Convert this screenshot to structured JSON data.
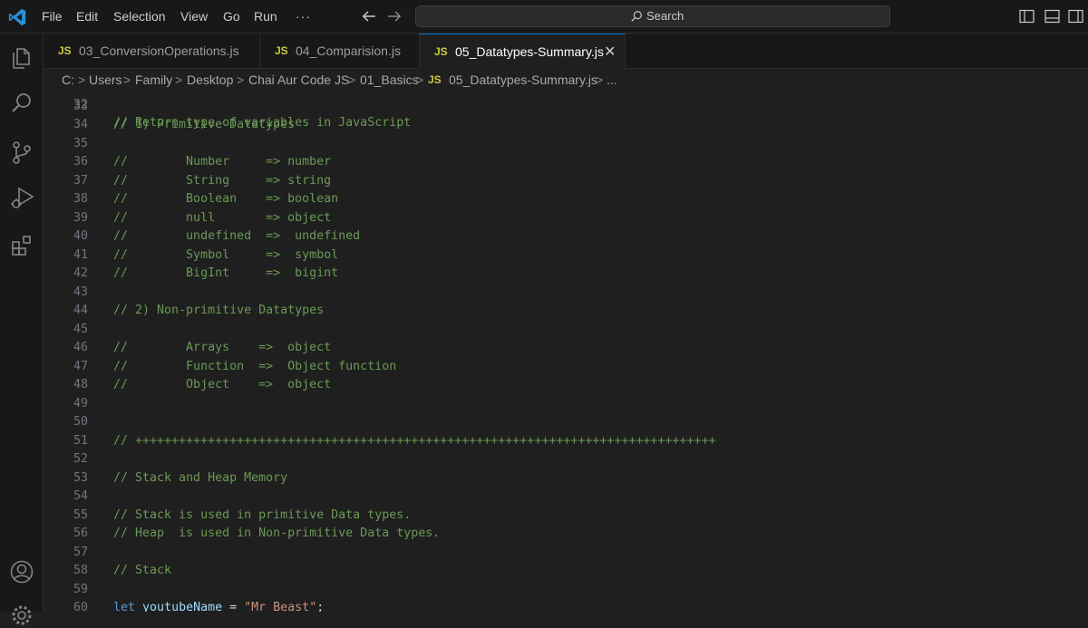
{
  "menu": [
    "File",
    "Edit",
    "Selection",
    "View",
    "Go",
    "Run",
    "···"
  ],
  "search": {
    "label": "Search"
  },
  "tabs": [
    {
      "badge": "JS",
      "label": "03_ConversionOperations.js"
    },
    {
      "badge": "JS",
      "label": "04_Comparision.js"
    },
    {
      "badge": "JS",
      "label": "05_Datatypes-Summary.js",
      "active": true
    }
  ],
  "tab_close_glyph": "✕",
  "breadcrumb": {
    "items": [
      "C:",
      "Users",
      "Family",
      "Desktop",
      "Chai Aur Code JS",
      "01_Basics"
    ],
    "file_badge": "JS",
    "file": "05_Datatypes-Summary.js",
    "tail": "...",
    "separator": ">"
  },
  "editor": {
    "partial_top_line": {
      "number": "32",
      "text": "// Return type of variables in JavaScript"
    },
    "lines": [
      {
        "n": "33",
        "text": ""
      },
      {
        "n": "34",
        "text": "// 1) Primitive Datatypes",
        "kind": "comment"
      },
      {
        "n": "35",
        "text": ""
      },
      {
        "n": "36",
        "text": "//        Number     => number",
        "kind": "comment"
      },
      {
        "n": "37",
        "text": "//        String     => string",
        "kind": "comment"
      },
      {
        "n": "38",
        "text": "//        Boolean    => boolean",
        "kind": "comment"
      },
      {
        "n": "39",
        "text": "//        null       => object",
        "kind": "comment"
      },
      {
        "n": "40",
        "text": "//        undefined  =>  undefined",
        "kind": "comment"
      },
      {
        "n": "41",
        "text": "//        Symbol     =>  symbol",
        "kind": "comment"
      },
      {
        "n": "42",
        "text": "//        BigInt     =>  bigint",
        "kind": "comment"
      },
      {
        "n": "43",
        "text": ""
      },
      {
        "n": "44",
        "text": "// 2) Non-primitive Datatypes",
        "kind": "comment"
      },
      {
        "n": "45",
        "text": ""
      },
      {
        "n": "46",
        "text": "//        Arrays    =>  object",
        "kind": "comment"
      },
      {
        "n": "47",
        "text": "//        Function  =>  Object function",
        "kind": "comment"
      },
      {
        "n": "48",
        "text": "//        Object    =>  object",
        "kind": "comment"
      },
      {
        "n": "49",
        "text": ""
      },
      {
        "n": "50",
        "text": ""
      },
      {
        "n": "51",
        "text": "// ++++++++++++++++++++++++++++++++++++++++++++++++++++++++++++++++++++++++++++++++",
        "kind": "comment"
      },
      {
        "n": "52",
        "text": ""
      },
      {
        "n": "53",
        "text": "// Stack and Heap Memory",
        "kind": "comment"
      },
      {
        "n": "54",
        "text": ""
      },
      {
        "n": "55",
        "text": "// Stack is used in primitive Data types.",
        "kind": "comment"
      },
      {
        "n": "56",
        "text": "// Heap  is used in Non-primitive Data types.",
        "kind": "comment"
      },
      {
        "n": "57",
        "text": ""
      },
      {
        "n": "58",
        "text": "// Stack",
        "kind": "comment"
      },
      {
        "n": "59",
        "text": ""
      },
      {
        "n": "60",
        "kind": "code",
        "tokens": [
          {
            "t": "keyword",
            "v": "let"
          },
          {
            "t": "op",
            "v": " "
          },
          {
            "t": "var",
            "v": "youtubeName"
          },
          {
            "t": "op",
            "v": " = "
          },
          {
            "t": "string",
            "v": "\"Mr Beast\""
          },
          {
            "t": "op",
            "v": ";"
          }
        ]
      }
    ]
  },
  "colors": {
    "comment": "#6a9955",
    "keyword": "#569cd6",
    "variable": "#9cdcfe",
    "string": "#ce9178",
    "js_badge": "#cbcb41",
    "accent": "#0078d4"
  },
  "icons": {
    "app": "vscode-logo-icon",
    "activity": [
      "explorer-icon",
      "search-icon",
      "source-control-icon",
      "run-debug-icon",
      "extensions-icon",
      "accounts-icon",
      "settings-gear-icon"
    ],
    "layout": [
      "toggle-primary-sidebar-icon",
      "toggle-panel-icon",
      "toggle-secondary-sidebar-icon"
    ]
  }
}
